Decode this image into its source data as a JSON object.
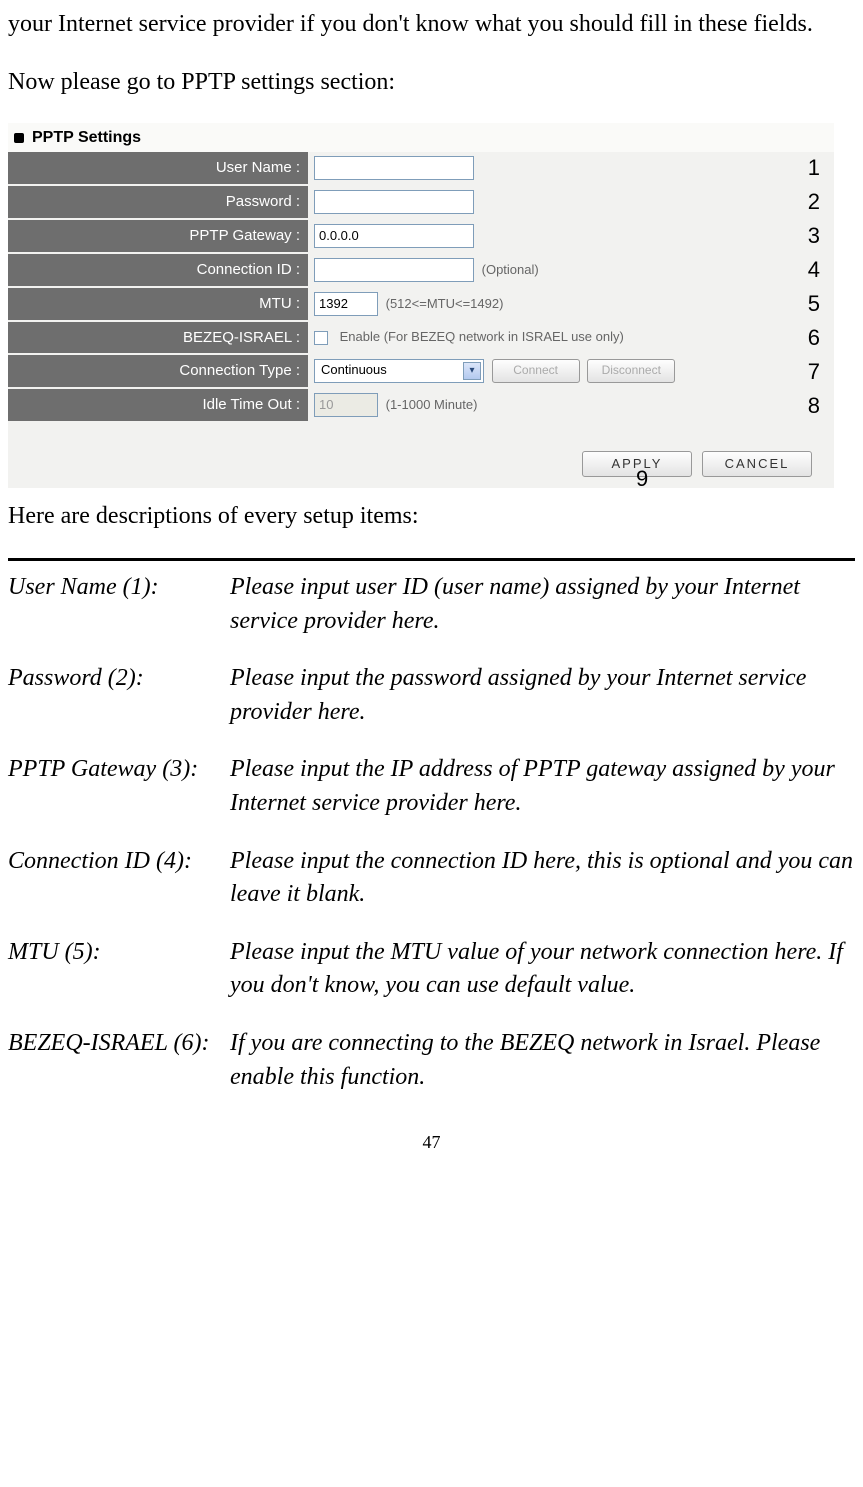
{
  "intro_para1": "your Internet service provider if you don't know what you should fill in these fields.",
  "intro_para2": "Now please go to PPTP settings section:",
  "screenshot": {
    "title": "PPTP Settings",
    "rows": {
      "user_name": {
        "label": "User Name :",
        "value": ""
      },
      "password": {
        "label": "Password :",
        "value": ""
      },
      "gateway": {
        "label": "PPTP Gateway :",
        "value": "0.0.0.0"
      },
      "conn_id": {
        "label": "Connection ID :",
        "value": "",
        "hint": "(Optional)"
      },
      "mtu": {
        "label": "MTU :",
        "value": "1392",
        "hint": "(512<=MTU<=1492)"
      },
      "bezeq": {
        "label": "BEZEQ-ISRAEL :",
        "hint": "Enable (For BEZEQ network in ISRAEL use only)"
      },
      "conn_type": {
        "label": "Connection Type :",
        "value": "Continuous",
        "connect": "Connect",
        "disconnect": "Disconnect"
      },
      "idle": {
        "label": "Idle Time Out :",
        "value": "10",
        "hint": "(1-1000 Minute)"
      }
    },
    "buttons": {
      "apply": "APPLY",
      "cancel": "CANCEL"
    },
    "nums": {
      "n1": "1",
      "n2": "2",
      "n3": "3",
      "n4": "4",
      "n5": "5",
      "n6": "6",
      "n7": "7",
      "n8": "8",
      "n9": "9"
    }
  },
  "desc_heading": "Here are descriptions of every setup items:",
  "items": {
    "i1": {
      "term": "User Name (1):",
      "def": "Please input user ID (user name) assigned by your Internet service provider here."
    },
    "i2": {
      "term": "Password (2):",
      "def": "Please input the password assigned by your Internet service provider here."
    },
    "i3": {
      "term": "PPTP Gateway (3):",
      "def": "Please input the IP address of PPTP gateway assigned by your Internet service provider here."
    },
    "i4": {
      "term": "Connection ID (4):",
      "def": "Please input the connection ID here, this is optional and you can leave it blank."
    },
    "i5": {
      "term": "MTU (5):",
      "def": "Please input the MTU value of your network connection here. If you don't know, you can use default value."
    },
    "i6": {
      "term": "BEZEQ-ISRAEL (6):",
      "def": "If you are connecting to the BEZEQ network in Israel. Please enable this function."
    }
  },
  "page_number": "47"
}
